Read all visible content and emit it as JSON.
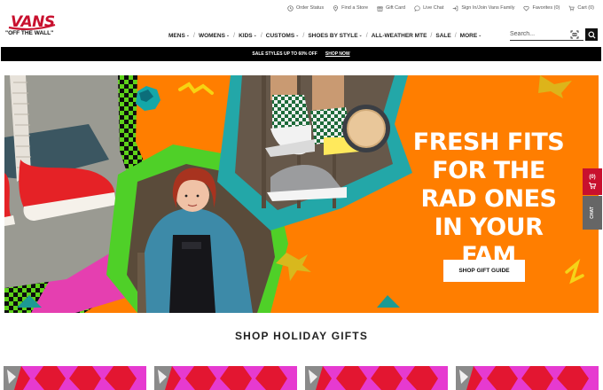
{
  "utility": {
    "order_status": "Order Status",
    "find_store": "Find a Store",
    "gift_card": "Gift Card",
    "live_chat": "Live Chat",
    "sign_in": "Sign In/Join Vans Family",
    "favorites": "Favorites (0)",
    "cart": "Cart (0)"
  },
  "logo": {
    "wordmark": "VANS",
    "tagline": "\"OFF THE WALL\""
  },
  "nav": {
    "items": [
      {
        "label": "MENS",
        "has_menu": true
      },
      {
        "label": "WOMENS",
        "has_menu": true
      },
      {
        "label": "KIDS",
        "has_menu": true
      },
      {
        "label": "CUSTOMS",
        "has_menu": true
      },
      {
        "label": "SHOES BY STYLE",
        "has_menu": true
      },
      {
        "label": "ALL-WEATHER MTE",
        "has_menu": false
      },
      {
        "label": "SALE",
        "has_menu": false
      },
      {
        "label": "MORE",
        "has_menu": true
      }
    ]
  },
  "search": {
    "placeholder": "Search..."
  },
  "promo": {
    "text": "SALE STYLES UP TO 60% OFF",
    "link": "SHOP NOW"
  },
  "hero": {
    "headline_lines": [
      "FRESH FITS",
      "FOR THE",
      "RAD ONES",
      "IN YOUR FAM"
    ],
    "cta": "SHOP GIFT GUIDE"
  },
  "side": {
    "cart_count": "(0)",
    "chat_label": "CHAT"
  },
  "section": {
    "title": "SHOP HOLIDAY GIFTS"
  },
  "colors": {
    "brand_red": "#c8102e",
    "hero_orange": "#ff7e00",
    "promo_black": "#000000"
  }
}
